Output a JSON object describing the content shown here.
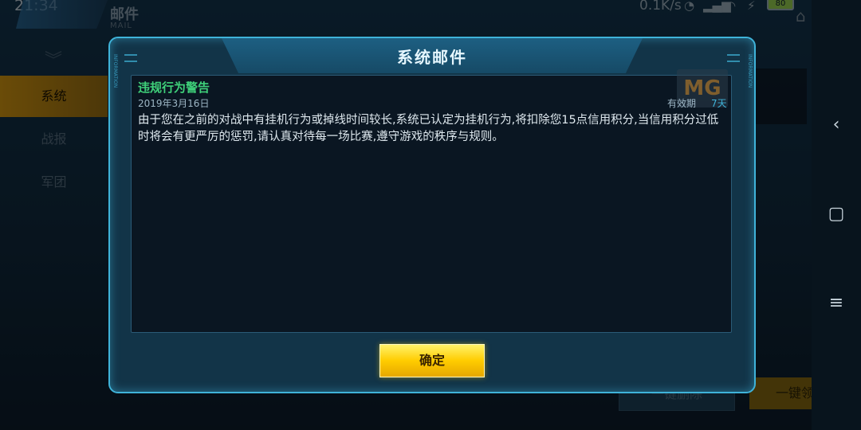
{
  "status_bar": {
    "time": "21:34",
    "net_speed": "0.1K/s",
    "battery": "80"
  },
  "page": {
    "title": "邮件",
    "subtitle": "MAIL"
  },
  "sidebar": {
    "items": [
      {
        "label": "系统",
        "active": true
      },
      {
        "label": "战报",
        "active": false
      },
      {
        "label": "军团",
        "active": false
      }
    ]
  },
  "footer": {
    "delete_all_label": "一键删除",
    "claim_all_label": "一键领取"
  },
  "dialog": {
    "title": "系统邮件",
    "side_left": "INFORMATION",
    "side_right": "INFORMATION",
    "mail": {
      "subject": "违规行为警告",
      "date": "2019年3月16日",
      "validity_label": "有效期",
      "validity_value": "7天",
      "body": "由于您在之前的对战中有挂机行为或掉线时间较长,系统已认定为挂机行为,将扣除您15点信用积分,当信用积分过低时将会有更严厉的惩罚,请认真对待每一场比赛,遵守游戏的秩序与规则。"
    },
    "confirm_label": "确定",
    "watermark": "MG"
  },
  "colors": {
    "accent": "#3fb3d9",
    "subject": "#3fd17a",
    "button": "#ffcc00",
    "active_tab": "#c28a0f"
  }
}
